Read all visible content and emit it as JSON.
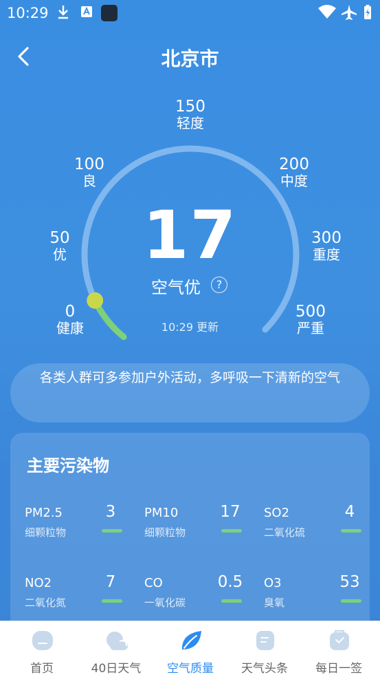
{
  "status_bar": {
    "time": "10:29"
  },
  "header": {
    "title": "北京市"
  },
  "gauge": {
    "labels": [
      {
        "value": "0",
        "text": "健康"
      },
      {
        "value": "50",
        "text": "优"
      },
      {
        "value": "100",
        "text": "良"
      },
      {
        "value": "150",
        "text": "轻度"
      },
      {
        "value": "200",
        "text": "中度"
      },
      {
        "value": "300",
        "text": "重度"
      },
      {
        "value": "500",
        "text": "严重"
      }
    ],
    "aqi": "17",
    "aqi_numeric": 17,
    "level": "空气优",
    "help": "?",
    "update_time": "10:29 更新",
    "colors": {
      "track": "#8cbef0",
      "good": "#7ed07a",
      "pointer": "#c9d84b"
    }
  },
  "advice": "各类人群可多参加户外活动，多呼吸一下清新的空气",
  "pollutants": {
    "title": "主要污染物",
    "items": [
      {
        "name": "PM2.5",
        "desc": "细颗粒物",
        "value": "3"
      },
      {
        "name": "PM10",
        "desc": "细颗粒物",
        "value": "17"
      },
      {
        "name": "SO2",
        "desc": "二氧化硫",
        "value": "4"
      },
      {
        "name": "NO2",
        "desc": "二氧化氮",
        "value": "7"
      },
      {
        "name": "CO",
        "desc": "一氧化碳",
        "value": "0.5"
      },
      {
        "name": "O3",
        "desc": "臭氧",
        "value": "53"
      }
    ],
    "bar_color": "#7ed07a"
  },
  "nav": {
    "items": [
      {
        "label": "首页",
        "icon": "home-icon"
      },
      {
        "label": "40日天气",
        "icon": "cloud-icon"
      },
      {
        "label": "空气质量",
        "icon": "leaf-icon"
      },
      {
        "label": "天气头条",
        "icon": "news-icon"
      },
      {
        "label": "每日一签",
        "icon": "bag-icon"
      }
    ],
    "active": "空气质量",
    "active_color": "#2d8cf0"
  }
}
